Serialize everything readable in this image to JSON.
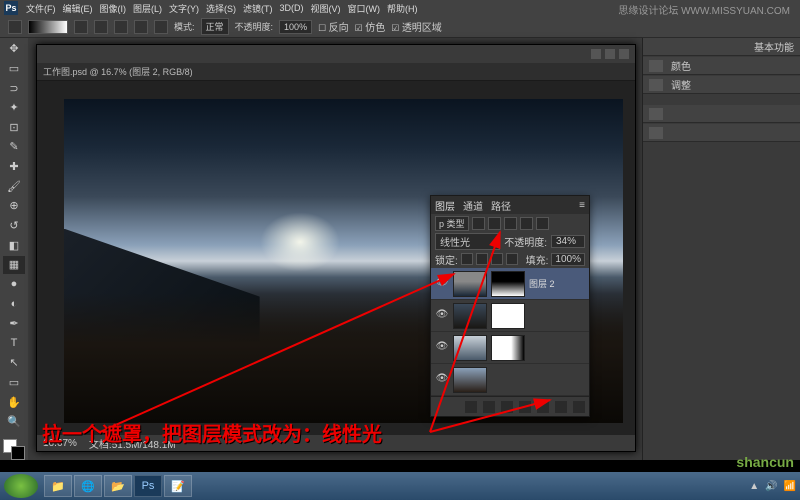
{
  "menubar": {
    "logo": "Ps",
    "items": [
      "文件(F)",
      "编辑(E)",
      "图像(I)",
      "图层(L)",
      "文字(Y)",
      "选择(S)",
      "滤镜(T)",
      "3D(D)",
      "视图(V)",
      "窗口(W)",
      "帮助(H)"
    ]
  },
  "optbar": {
    "mode_label": "模式:",
    "mode_value": "正常",
    "opacity_label": "不透明度:",
    "opacity_value": "100%",
    "reverse": "反向",
    "dither": "仿色",
    "trans": "透明区域"
  },
  "doc": {
    "tab": "工作图.psd @ 16.7% (图层 2, RGB/8)",
    "zoom": "16.67%",
    "status": "文档:51.5M/148.1M"
  },
  "layers": {
    "tabs": [
      "图层",
      "通道",
      "路径"
    ],
    "kind_label": "p 类型",
    "blend_mode": "线性光",
    "opacity_label": "不透明度:",
    "opacity_value": "34%",
    "lock_label": "锁定:",
    "fill_label": "填充:",
    "fill_value": "100%",
    "layer_name": "图层 2"
  },
  "annotation": "拉一个遮罩，把图层模式改为：线性光",
  "watermarks": {
    "top": "思缘设计论坛  WWW.MISSYUAN.COM",
    "bottom": "shancun"
  },
  "rightpanels": {
    "group_label": "基本功能",
    "items": [
      "颜色",
      "调整"
    ]
  },
  "taskbar": {
    "time": "",
    "icons": [
      "📁",
      "🌐",
      "📂",
      "Ps",
      "📝"
    ]
  }
}
